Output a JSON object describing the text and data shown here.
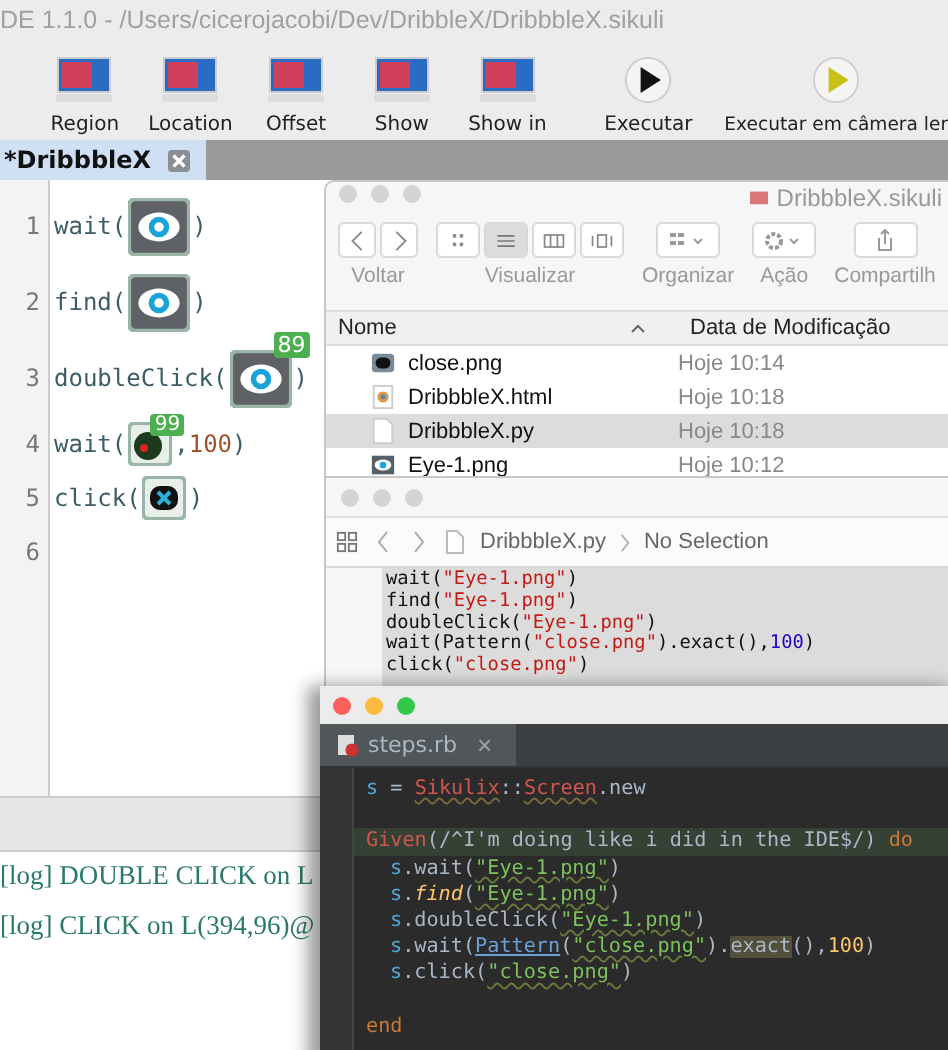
{
  "ide": {
    "title": "DE 1.1.0 - /Users/cicerojacobi/Dev/DribbleX/DribbbleX.sikuli",
    "toolbar": [
      {
        "label": "Region",
        "kind": "capture"
      },
      {
        "label": "Location",
        "kind": "capture"
      },
      {
        "label": "Offset",
        "kind": "capture"
      },
      {
        "label": "Show",
        "kind": "capture"
      },
      {
        "label": "Show in",
        "kind": "capture"
      },
      {
        "label": "Executar",
        "kind": "run"
      },
      {
        "label": "Executar em câmera ler",
        "kind": "slow-run"
      }
    ],
    "tabs": [
      {
        "label": "*DribbbleX",
        "selected": true
      }
    ],
    "lines": [
      {
        "number": "1",
        "parts": [
          {
            "kind": "text",
            "text": "wait("
          },
          {
            "kind": "eye-image"
          },
          {
            "kind": "text",
            "text": ")"
          }
        ]
      },
      {
        "number": "2",
        "parts": [
          {
            "kind": "text",
            "text": "find("
          },
          {
            "kind": "eye-image"
          },
          {
            "kind": "text",
            "text": ")"
          }
        ]
      },
      {
        "number": "3",
        "parts": [
          {
            "kind": "text",
            "text": "doubleClick("
          },
          {
            "kind": "eye-image",
            "badge": "89"
          },
          {
            "kind": "text",
            "text": ")"
          }
        ]
      },
      {
        "number": "4",
        "parts": [
          {
            "kind": "text",
            "text": "wait("
          },
          {
            "kind": "dot-image",
            "badge": "99"
          },
          {
            "kind": "text",
            "text": ","
          },
          {
            "kind": "number",
            "text": "100"
          },
          {
            "kind": "text",
            "text": ")"
          }
        ]
      },
      {
        "number": "5",
        "parts": [
          {
            "kind": "text",
            "text": "click("
          },
          {
            "kind": "close-image"
          },
          {
            "kind": "text",
            "text": ")"
          }
        ]
      },
      {
        "number": "6"
      }
    ],
    "log": [
      "[log] DOUBLE CLICK on L",
      "[log] CLICK on L(394,96)@"
    ]
  },
  "finder": {
    "title": "DribbbleX.sikuli",
    "toolbar_labels": [
      "Voltar",
      "Visualizar",
      "Organizar",
      "Ação",
      "Compartilh"
    ],
    "view_modes": [
      {
        "kind": "icons",
        "selected": false
      },
      {
        "kind": "list",
        "selected": true
      },
      {
        "kind": "columns",
        "selected": false
      },
      {
        "kind": "cover",
        "selected": false
      }
    ],
    "columns": [
      "Nome",
      "Data de Modificação"
    ],
    "rows": [
      {
        "name": "close.png",
        "date": "Hoje 10:14",
        "kind": "close-image",
        "selected": false
      },
      {
        "name": "DribbbleX.html",
        "date": "Hoje 10:18",
        "kind": "browser",
        "selected": false
      },
      {
        "name": "DribbbleX.py",
        "date": "Hoje 10:18",
        "kind": "blank",
        "selected": true
      },
      {
        "name": "Eye-1.png",
        "date": "Hoje 10:12",
        "kind": "eye-image",
        "selected": false
      }
    ]
  },
  "xcode": {
    "breadcrumb": [
      "DribbbleX.py",
      "No Selection"
    ],
    "lines": [
      {
        "parts": [
          {
            "kind": "plain",
            "text": "wait("
          },
          {
            "kind": "string",
            "text": "\"Eye-1.png\""
          },
          {
            "kind": "plain",
            "text": ")"
          }
        ]
      },
      {
        "parts": [
          {
            "kind": "plain",
            "text": "find("
          },
          {
            "kind": "string",
            "text": "\"Eye-1.png\""
          },
          {
            "kind": "plain",
            "text": ")"
          }
        ]
      },
      {
        "parts": [
          {
            "kind": "plain",
            "text": "doubleClick("
          },
          {
            "kind": "string",
            "text": "\"Eye-1.png\""
          },
          {
            "kind": "plain",
            "text": ")"
          }
        ]
      },
      {
        "parts": [
          {
            "kind": "plain",
            "text": "wait(Pattern("
          },
          {
            "kind": "string",
            "text": "\"close.png\""
          },
          {
            "kind": "plain",
            "text": ").exact(),"
          },
          {
            "kind": "number",
            "text": "100"
          },
          {
            "kind": "plain",
            "text": ")"
          }
        ]
      },
      {
        "parts": [
          {
            "kind": "plain",
            "text": "click("
          },
          {
            "kind": "string",
            "text": "\"close.png\""
          },
          {
            "kind": "plain",
            "text": ")"
          }
        ]
      }
    ]
  },
  "rubymine": {
    "tab": {
      "label": "steps.rb",
      "close": "×"
    },
    "lines": [
      {
        "kind": "code",
        "parts": [
          {
            "kind": "var",
            "text": "s"
          },
          {
            "kind": "plain",
            "text": " = "
          },
          {
            "kind": "const",
            "text": "Sikulix"
          },
          {
            "kind": "plain",
            "text": "::"
          },
          {
            "kind": "const",
            "text": "Screen"
          },
          {
            "kind": "plain",
            "text": ".new"
          }
        ]
      },
      {
        "kind": "blank"
      },
      {
        "kind": "code",
        "highlight": true,
        "parts": [
          {
            "kind": "call",
            "text": "Given"
          },
          {
            "kind": "plain",
            "text": "(/^I'm doing like i did in the IDE$/) "
          },
          {
            "kind": "keyword",
            "text": "do"
          }
        ]
      },
      {
        "kind": "code",
        "indent": true,
        "parts": [
          {
            "kind": "var",
            "text": "s"
          },
          {
            "kind": "plain",
            "text": ".wait("
          },
          {
            "kind": "string",
            "text": "\"Eye-1.png\""
          },
          {
            "kind": "plain",
            "text": ")"
          }
        ]
      },
      {
        "kind": "code",
        "indent": true,
        "parts": [
          {
            "kind": "var",
            "text": "s"
          },
          {
            "kind": "plain",
            "text": "."
          },
          {
            "kind": "method",
            "text": "find"
          },
          {
            "kind": "plain",
            "text": "("
          },
          {
            "kind": "string",
            "text": "\"Eye-1.png\""
          },
          {
            "kind": "plain",
            "text": ")"
          }
        ]
      },
      {
        "kind": "code",
        "indent": true,
        "parts": [
          {
            "kind": "var",
            "text": "s"
          },
          {
            "kind": "plain",
            "text": ".doubleClick("
          },
          {
            "kind": "string",
            "text": "\"Eye-1.png\""
          },
          {
            "kind": "plain",
            "text": ")"
          }
        ]
      },
      {
        "kind": "code",
        "indent": true,
        "parts": [
          {
            "kind": "var",
            "text": "s"
          },
          {
            "kind": "plain",
            "text": ".wait("
          },
          {
            "kind": "class",
            "text": "Pattern"
          },
          {
            "kind": "plain",
            "text": "("
          },
          {
            "kind": "string",
            "text": "\"close.png\""
          },
          {
            "kind": "plain",
            "text": ")."
          },
          {
            "kind": "marked",
            "text": "exact"
          },
          {
            "kind": "plain",
            "text": "(),"
          },
          {
            "kind": "number",
            "text": "100"
          },
          {
            "kind": "plain",
            "text": ")"
          }
        ]
      },
      {
        "kind": "code",
        "indent": true,
        "parts": [
          {
            "kind": "var",
            "text": "s"
          },
          {
            "kind": "plain",
            "text": ".click("
          },
          {
            "kind": "string",
            "text": "\"close.png\""
          },
          {
            "kind": "plain",
            "text": ")"
          }
        ]
      },
      {
        "kind": "blank"
      },
      {
        "kind": "code",
        "parts": [
          {
            "kind": "keyword",
            "text": "end"
          }
        ]
      }
    ]
  }
}
